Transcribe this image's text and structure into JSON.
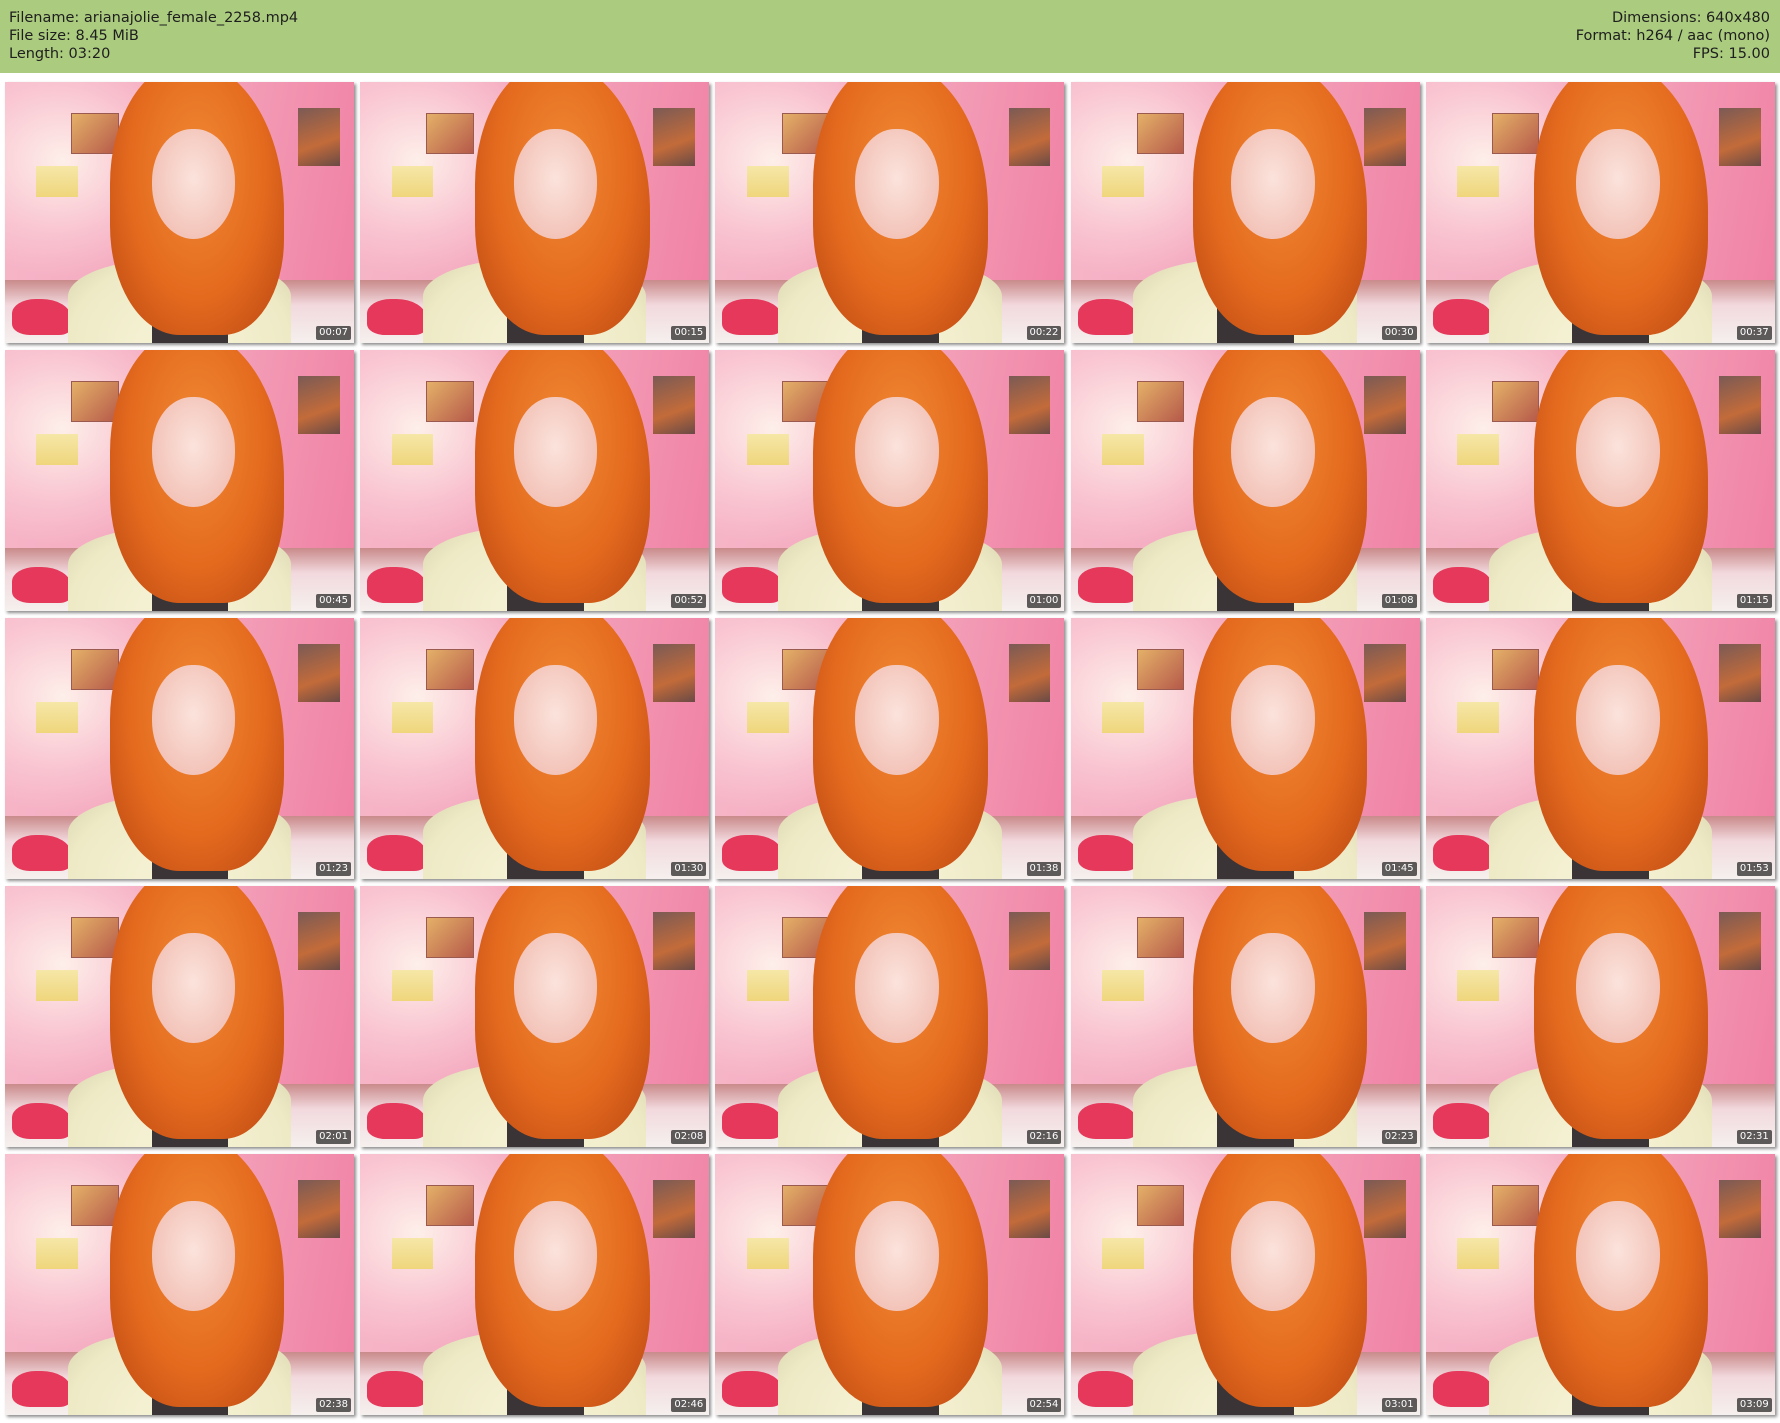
{
  "header": {
    "filename": "Filename: arianajolie_female_2258.mp4",
    "filesize": "File size: 8.45 MiB",
    "length": "Length: 03:20",
    "dimensions": "Dimensions: 640x480",
    "format": "Format: h264 / aac (mono)",
    "fps": "FPS: 15.00"
  },
  "thumbnails": [
    {
      "timestamp": "00:07"
    },
    {
      "timestamp": "00:15"
    },
    {
      "timestamp": "00:22"
    },
    {
      "timestamp": "00:30"
    },
    {
      "timestamp": "00:37"
    },
    {
      "timestamp": "00:45"
    },
    {
      "timestamp": "00:52"
    },
    {
      "timestamp": "01:00"
    },
    {
      "timestamp": "01:08"
    },
    {
      "timestamp": "01:15"
    },
    {
      "timestamp": "01:23"
    },
    {
      "timestamp": "01:30"
    },
    {
      "timestamp": "01:38"
    },
    {
      "timestamp": "01:45"
    },
    {
      "timestamp": "01:53"
    },
    {
      "timestamp": "02:01"
    },
    {
      "timestamp": "02:08"
    },
    {
      "timestamp": "02:16"
    },
    {
      "timestamp": "02:23"
    },
    {
      "timestamp": "02:31"
    },
    {
      "timestamp": "02:38"
    },
    {
      "timestamp": "02:46"
    },
    {
      "timestamp": "02:54"
    },
    {
      "timestamp": "03:01"
    },
    {
      "timestamp": "03:09"
    }
  ],
  "colors": {
    "header_background": "#abcb7f"
  }
}
